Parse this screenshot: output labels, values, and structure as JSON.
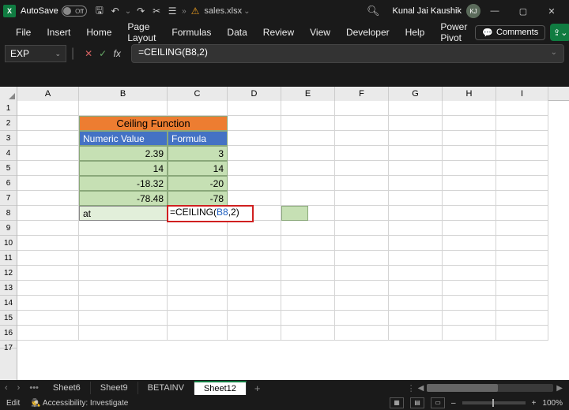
{
  "titlebar": {
    "autosave_label": "AutoSave",
    "autosave_state": "Off",
    "filename": "sales.xlsx",
    "search_icon_glyph": "🔍︎",
    "user_name": "Kunal Jai Kaushik",
    "user_initials": "KJ"
  },
  "ribbon": {
    "tabs": [
      "File",
      "Insert",
      "Home",
      "Page Layout",
      "Formulas",
      "Data",
      "Review",
      "View",
      "Developer",
      "Help",
      "Power Pivot"
    ],
    "comments_label": "Comments"
  },
  "formula_bar": {
    "name_box": "EXP",
    "cancel": "✕",
    "enter": "✓",
    "fx": "fx",
    "formula_text": "=CEILING(B8,2)"
  },
  "columns": [
    "A",
    "B",
    "C",
    "D",
    "E",
    "F",
    "G",
    "H",
    "I"
  ],
  "rows": [
    "1",
    "2",
    "3",
    "4",
    "5",
    "6",
    "7",
    "8",
    "9",
    "10",
    "11",
    "12",
    "13",
    "14",
    "15",
    "16",
    "17"
  ],
  "table": {
    "title": "Ceiling Function",
    "header_b": "Numeric Value",
    "header_c": "Formula",
    "r4_b": "2.39",
    "r4_c": "3",
    "r5_b": "14",
    "r5_c": "14",
    "r6_b": "-18.32",
    "r6_c": "-20",
    "r7_b": "-78.48",
    "r7_c": "-78",
    "r8_b": "at",
    "r8_formula_prefix": "=CEILING(",
    "r8_formula_ref": "B8",
    "r8_formula_suffix": ",2)"
  },
  "sheet_tabs": {
    "tabs": [
      "Sheet6",
      "Sheet9",
      "BETAINV",
      "Sheet12"
    ],
    "active": "Sheet12"
  },
  "status": {
    "mode": "Edit",
    "accessibility": "Accessibility: Investigate",
    "zoom": "100%"
  }
}
